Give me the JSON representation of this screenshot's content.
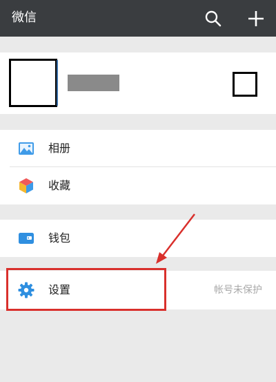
{
  "header": {
    "title": "微信",
    "search_icon": "search-icon",
    "add_icon": "plus-icon"
  },
  "menu": {
    "album_label": "相册",
    "favorites_label": "收藏",
    "wallet_label": "钱包",
    "settings_label": "设置",
    "settings_status": "帐号未保护"
  },
  "colors": {
    "header_bg": "#3a3d40",
    "accent_blue": "#2f8fe0",
    "highlight_red": "#d9302c"
  }
}
